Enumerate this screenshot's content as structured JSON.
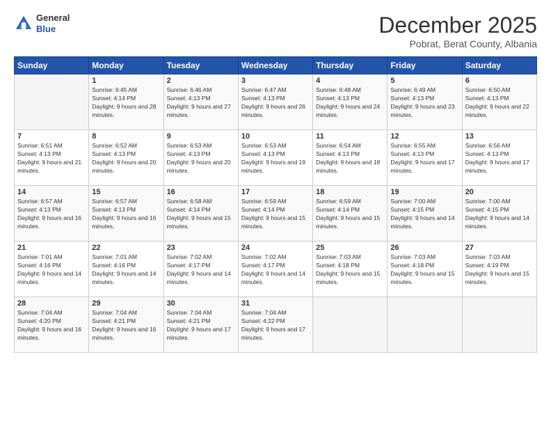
{
  "logo": {
    "line1": "General",
    "line2": "Blue"
  },
  "header": {
    "month": "December 2025",
    "location": "Pobrat, Berat County, Albania"
  },
  "weekdays": [
    "Sunday",
    "Monday",
    "Tuesday",
    "Wednesday",
    "Thursday",
    "Friday",
    "Saturday"
  ],
  "weeks": [
    [
      {
        "day": "",
        "sunrise": "",
        "sunset": "",
        "daylight": ""
      },
      {
        "day": "1",
        "sunrise": "Sunrise: 6:45 AM",
        "sunset": "Sunset: 4:14 PM",
        "daylight": "Daylight: 9 hours and 28 minutes."
      },
      {
        "day": "2",
        "sunrise": "Sunrise: 6:46 AM",
        "sunset": "Sunset: 4:13 PM",
        "daylight": "Daylight: 9 hours and 27 minutes."
      },
      {
        "day": "3",
        "sunrise": "Sunrise: 6:47 AM",
        "sunset": "Sunset: 4:13 PM",
        "daylight": "Daylight: 9 hours and 26 minutes."
      },
      {
        "day": "4",
        "sunrise": "Sunrise: 6:48 AM",
        "sunset": "Sunset: 4:13 PM",
        "daylight": "Daylight: 9 hours and 24 minutes."
      },
      {
        "day": "5",
        "sunrise": "Sunrise: 6:49 AM",
        "sunset": "Sunset: 4:13 PM",
        "daylight": "Daylight: 9 hours and 23 minutes."
      },
      {
        "day": "6",
        "sunrise": "Sunrise: 6:50 AM",
        "sunset": "Sunset: 4:13 PM",
        "daylight": "Daylight: 9 hours and 22 minutes."
      }
    ],
    [
      {
        "day": "7",
        "sunrise": "Sunrise: 6:51 AM",
        "sunset": "Sunset: 4:13 PM",
        "daylight": "Daylight: 9 hours and 21 minutes."
      },
      {
        "day": "8",
        "sunrise": "Sunrise: 6:52 AM",
        "sunset": "Sunset: 4:13 PM",
        "daylight": "Daylight: 9 hours and 20 minutes."
      },
      {
        "day": "9",
        "sunrise": "Sunrise: 6:53 AM",
        "sunset": "Sunset: 4:13 PM",
        "daylight": "Daylight: 9 hours and 20 minutes."
      },
      {
        "day": "10",
        "sunrise": "Sunrise: 6:53 AM",
        "sunset": "Sunset: 4:13 PM",
        "daylight": "Daylight: 9 hours and 19 minutes."
      },
      {
        "day": "11",
        "sunrise": "Sunrise: 6:54 AM",
        "sunset": "Sunset: 4:13 PM",
        "daylight": "Daylight: 9 hours and 18 minutes."
      },
      {
        "day": "12",
        "sunrise": "Sunrise: 6:55 AM",
        "sunset": "Sunset: 4:13 PM",
        "daylight": "Daylight: 9 hours and 17 minutes."
      },
      {
        "day": "13",
        "sunrise": "Sunrise: 6:56 AM",
        "sunset": "Sunset: 4:13 PM",
        "daylight": "Daylight: 9 hours and 17 minutes."
      }
    ],
    [
      {
        "day": "14",
        "sunrise": "Sunrise: 6:57 AM",
        "sunset": "Sunset: 4:13 PM",
        "daylight": "Daylight: 9 hours and 16 minutes."
      },
      {
        "day": "15",
        "sunrise": "Sunrise: 6:57 AM",
        "sunset": "Sunset: 4:13 PM",
        "daylight": "Daylight: 9 hours and 16 minutes."
      },
      {
        "day": "16",
        "sunrise": "Sunrise: 6:58 AM",
        "sunset": "Sunset: 4:14 PM",
        "daylight": "Daylight: 9 hours and 15 minutes."
      },
      {
        "day": "17",
        "sunrise": "Sunrise: 6:59 AM",
        "sunset": "Sunset: 4:14 PM",
        "daylight": "Daylight: 9 hours and 15 minutes."
      },
      {
        "day": "18",
        "sunrise": "Sunrise: 6:59 AM",
        "sunset": "Sunset: 4:14 PM",
        "daylight": "Daylight: 9 hours and 15 minutes."
      },
      {
        "day": "19",
        "sunrise": "Sunrise: 7:00 AM",
        "sunset": "Sunset: 4:15 PM",
        "daylight": "Daylight: 9 hours and 14 minutes."
      },
      {
        "day": "20",
        "sunrise": "Sunrise: 7:00 AM",
        "sunset": "Sunset: 4:15 PM",
        "daylight": "Daylight: 9 hours and 14 minutes."
      }
    ],
    [
      {
        "day": "21",
        "sunrise": "Sunrise: 7:01 AM",
        "sunset": "Sunset: 4:16 PM",
        "daylight": "Daylight: 9 hours and 14 minutes."
      },
      {
        "day": "22",
        "sunrise": "Sunrise: 7:01 AM",
        "sunset": "Sunset: 4:16 PM",
        "daylight": "Daylight: 9 hours and 14 minutes."
      },
      {
        "day": "23",
        "sunrise": "Sunrise: 7:02 AM",
        "sunset": "Sunset: 4:17 PM",
        "daylight": "Daylight: 9 hours and 14 minutes."
      },
      {
        "day": "24",
        "sunrise": "Sunrise: 7:02 AM",
        "sunset": "Sunset: 4:17 PM",
        "daylight": "Daylight: 9 hours and 14 minutes."
      },
      {
        "day": "25",
        "sunrise": "Sunrise: 7:03 AM",
        "sunset": "Sunset: 4:18 PM",
        "daylight": "Daylight: 9 hours and 15 minutes."
      },
      {
        "day": "26",
        "sunrise": "Sunrise: 7:03 AM",
        "sunset": "Sunset: 4:18 PM",
        "daylight": "Daylight: 9 hours and 15 minutes."
      },
      {
        "day": "27",
        "sunrise": "Sunrise: 7:03 AM",
        "sunset": "Sunset: 4:19 PM",
        "daylight": "Daylight: 9 hours and 15 minutes."
      }
    ],
    [
      {
        "day": "28",
        "sunrise": "Sunrise: 7:04 AM",
        "sunset": "Sunset: 4:20 PM",
        "daylight": "Daylight: 9 hours and 16 minutes."
      },
      {
        "day": "29",
        "sunrise": "Sunrise: 7:04 AM",
        "sunset": "Sunset: 4:21 PM",
        "daylight": "Daylight: 9 hours and 16 minutes."
      },
      {
        "day": "30",
        "sunrise": "Sunrise: 7:04 AM",
        "sunset": "Sunset: 4:21 PM",
        "daylight": "Daylight: 9 hours and 17 minutes."
      },
      {
        "day": "31",
        "sunrise": "Sunrise: 7:04 AM",
        "sunset": "Sunset: 4:22 PM",
        "daylight": "Daylight: 9 hours and 17 minutes."
      },
      {
        "day": "",
        "sunrise": "",
        "sunset": "",
        "daylight": ""
      },
      {
        "day": "",
        "sunrise": "",
        "sunset": "",
        "daylight": ""
      },
      {
        "day": "",
        "sunrise": "",
        "sunset": "",
        "daylight": ""
      }
    ]
  ]
}
